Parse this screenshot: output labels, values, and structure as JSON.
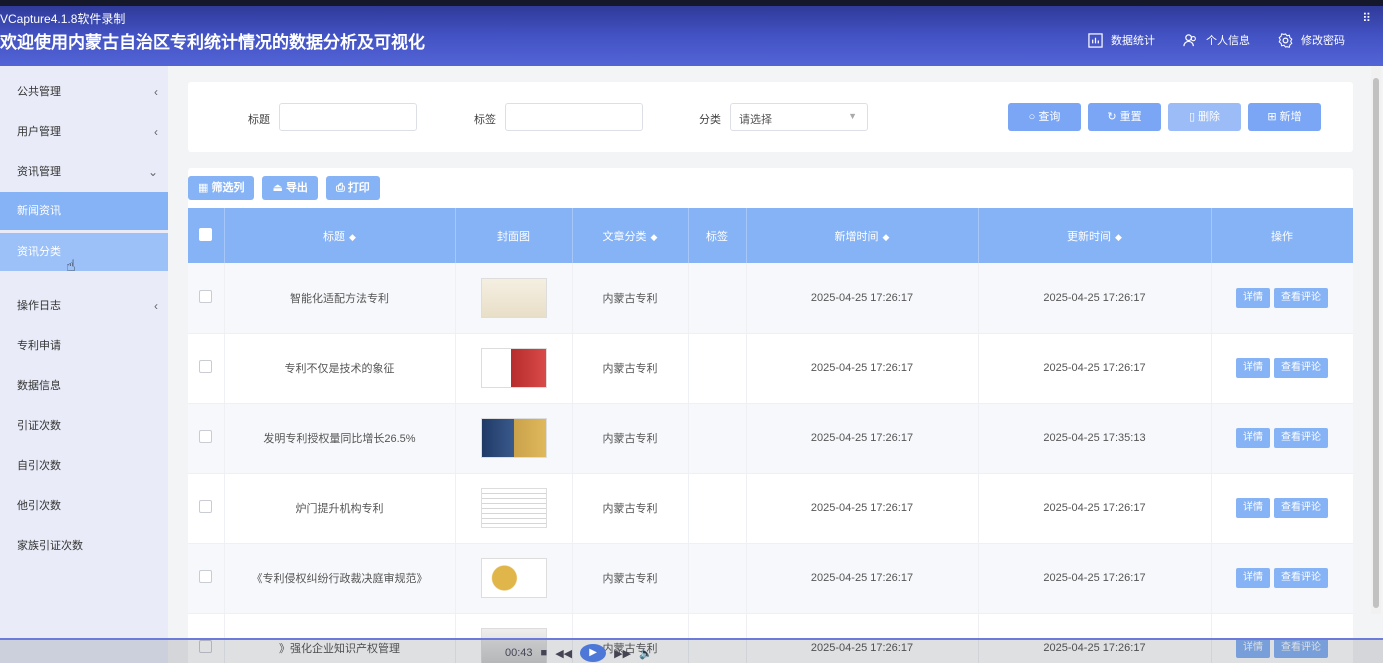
{
  "recorder": {
    "title": "VCapture4.1.8软件录制",
    "corner": "⠿"
  },
  "header": {
    "title": "欢迎使用内蒙古自治区专利统计情况的数据分析及可视化",
    "nav": [
      "数据统计",
      "个人信息",
      "修改密码"
    ]
  },
  "sidebar": {
    "items": [
      {
        "label": "公共管理",
        "arrow": "‹"
      },
      {
        "label": "用户管理",
        "arrow": "‹"
      },
      {
        "label": "资讯管理",
        "arrow": "⌄"
      }
    ],
    "sub_items": [
      "新闻资讯",
      "资讯分类"
    ],
    "more_items": [
      {
        "label": "操作日志",
        "arrow": "‹"
      },
      {
        "label": "专利申请",
        "arrow": ""
      },
      {
        "label": "数据信息",
        "arrow": ""
      },
      {
        "label": "引证次数",
        "arrow": ""
      },
      {
        "label": "自引次数",
        "arrow": ""
      },
      {
        "label": "他引次数",
        "arrow": ""
      },
      {
        "label": "家族引证次数",
        "arrow": ""
      }
    ]
  },
  "search": {
    "title_label": "标题",
    "tag_label": "标签",
    "category_label": "分类",
    "category_placeholder": "请选择",
    "buttons": [
      "查询",
      "重置",
      "删除",
      "新增"
    ]
  },
  "toolbar": [
    "筛选列",
    "导出",
    "打印"
  ],
  "table": {
    "headers": [
      "标题",
      "封面图",
      "文章分类",
      "标签",
      "新增时间",
      "更新时间",
      "操作"
    ],
    "rows": [
      {
        "title": "智能化适配方法专利",
        "category": "内蒙古专利",
        "tag": "",
        "created": "2025-04-25 17:26:17",
        "updated": "2025-04-25 17:26:17"
      },
      {
        "title": "专利不仅是技术的象征",
        "category": "内蒙古专利",
        "tag": "",
        "created": "2025-04-25 17:26:17",
        "updated": "2025-04-25 17:26:17"
      },
      {
        "title": "发明专利授权量同比增长26.5%",
        "category": "内蒙古专利",
        "tag": "",
        "created": "2025-04-25 17:26:17",
        "updated": "2025-04-25 17:35:13"
      },
      {
        "title": "炉门提升机构专利",
        "category": "内蒙古专利",
        "tag": "",
        "created": "2025-04-25 17:26:17",
        "updated": "2025-04-25 17:26:17"
      },
      {
        "title": "《专利侵权纠纷行政裁决庭审规范》",
        "category": "内蒙古专利",
        "tag": "",
        "created": "2025-04-25 17:26:17",
        "updated": "2025-04-25 17:26:17"
      },
      {
        "title": "》强化企业知识产权管理",
        "category": "内蒙古专利",
        "tag": "",
        "created": "2025-04-25 17:26:17",
        "updated": "2025-04-25 17:26:17"
      }
    ],
    "op_detail": "详情",
    "op_comment": "查看评论"
  },
  "player": {
    "time": "00:43"
  }
}
